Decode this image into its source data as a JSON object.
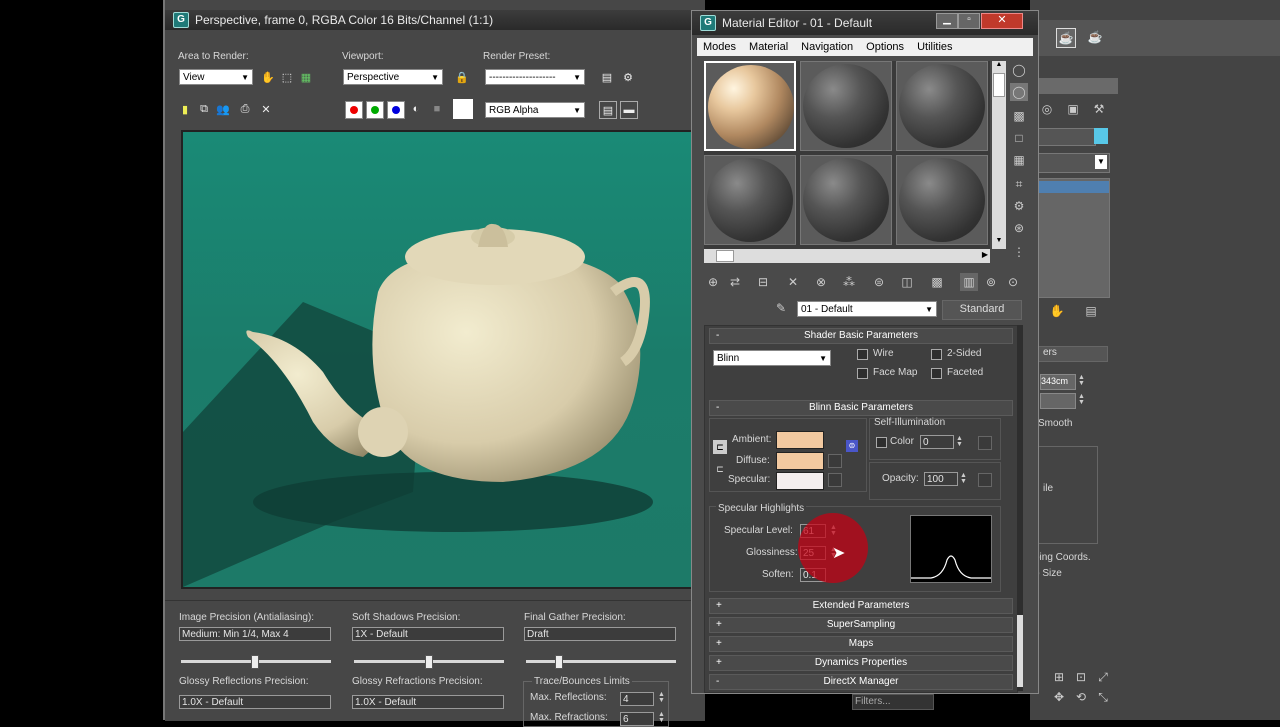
{
  "render_window": {
    "title": "Perspective, frame 0, RGBA Color 16 Bits/Channel (1:1)",
    "area_to_render_label": "Area to Render:",
    "area_to_render_value": "View",
    "viewport_label": "Viewport:",
    "viewport_value": "Perspective",
    "render_preset_label": "Render Preset:",
    "render_preset_value": "--------------------",
    "channel_value": "RGB Alpha",
    "bottom": {
      "image_precision_label": "Image Precision (Antialiasing):",
      "image_precision_value": "Medium: Min 1/4, Max 4",
      "soft_shadows_label": "Soft Shadows Precision:",
      "soft_shadows_value": "1X - Default",
      "final_gather_label": "Final Gather Precision:",
      "final_gather_value": "Draft",
      "glossy_reflections_label": "Glossy Reflections Precision:",
      "glossy_reflections_value": "1.0X - Default",
      "glossy_refractions_label": "Glossy Refractions Precision:",
      "glossy_refractions_value": "1.0X - Default",
      "trace_label": "Trace/Bounces Limits",
      "max_reflections_label": "Max. Reflections:",
      "max_reflections_value": "4",
      "max_refractions_label": "Max. Refractions:",
      "max_refractions_value": "6"
    }
  },
  "material_editor": {
    "title": "Material Editor - 01 - Default",
    "menu": [
      "Modes",
      "Material",
      "Navigation",
      "Options",
      "Utilities"
    ],
    "material_name": "01 - Default",
    "material_type": "Standard",
    "shader_rollout": "Shader Basic Parameters",
    "shader_value": "Blinn",
    "wire_label": "Wire",
    "two_sided_label": "2-Sided",
    "face_map_label": "Face Map",
    "faceted_label": "Faceted",
    "blinn_rollout": "Blinn Basic Parameters",
    "self_illum_label": "Self-Illumination",
    "color_label": "Color",
    "color_value": "0",
    "ambient_label": "Ambient:",
    "diffuse_label": "Diffuse:",
    "specular_label": "Specular:",
    "opacity_label": "Opacity:",
    "opacity_value": "100",
    "specular_highlights_label": "Specular Highlights",
    "specular_level_label": "Specular Level:",
    "specular_level_value": "61",
    "glossiness_label": "Glossiness:",
    "glossiness_value": "25",
    "soften_label": "Soften:",
    "soften_value": "0.1",
    "rollouts": [
      {
        "sign": "+",
        "label": "Extended Parameters"
      },
      {
        "sign": "+",
        "label": "SuperSampling"
      },
      {
        "sign": "+",
        "label": "Maps"
      },
      {
        "sign": "+",
        "label": "Dynamics Properties"
      },
      {
        "sign": "-",
        "label": "DirectX Manager"
      }
    ],
    "colors": {
      "ambient": "#f2c9a0",
      "diffuse": "#f2c9a0",
      "specular": "#f4eeee"
    }
  },
  "right_panel": {
    "value_field": "343cm",
    "parameters_label": "ers",
    "smooth_label": "Smooth",
    "ile_label": "ile",
    "mapping_coords_label": "ping Coords.",
    "map_size_label": "p Size",
    "filters_label": "Filters..."
  },
  "render_colors": {
    "teal": "#1e8a78",
    "teapot": "#e6dcc0"
  }
}
